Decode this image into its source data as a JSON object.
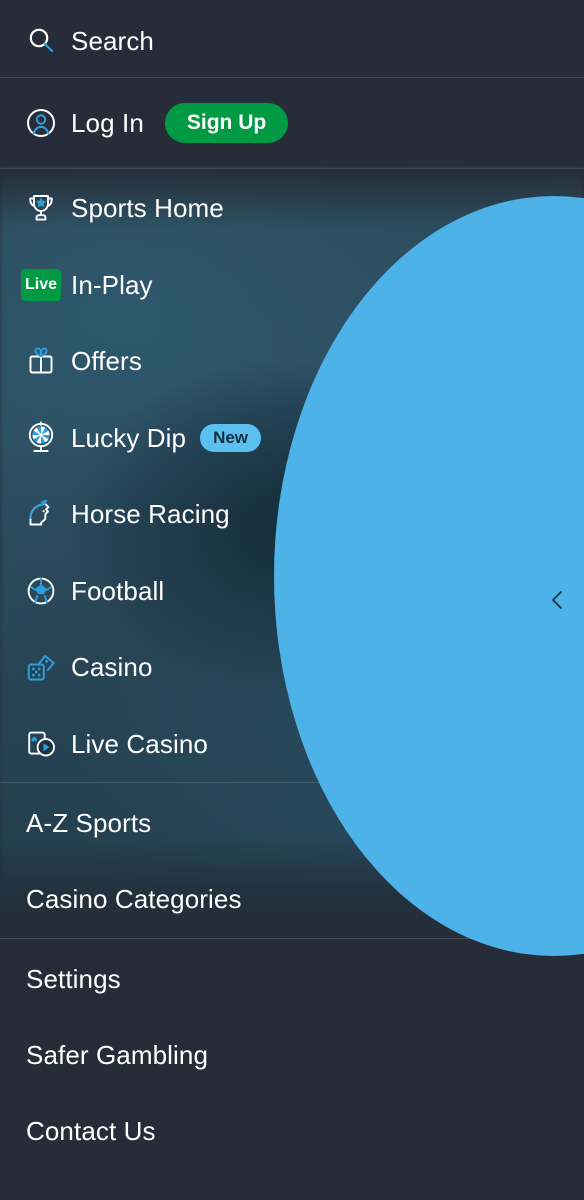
{
  "app": {
    "title": "Sportsbook Navigation Drawer",
    "background_color": "#262d38",
    "hero_background_color": "#2d5063",
    "accent_blue": "#2f9fdb",
    "panel_blue": "#4db2e8",
    "accent_green": "#009a44",
    "badge_blue": "#5bc0ef",
    "text_color": "#ffffff"
  },
  "top": {
    "search": {
      "label": "Search",
      "icon": "search-icon"
    },
    "account": {
      "label": "Log In",
      "icon": "account-circle-icon"
    },
    "signup": {
      "label": "Sign Up"
    }
  },
  "primary_nav": {
    "items": [
      {
        "label": "Sports Home",
        "icon": "trophy-icon",
        "badge": null
      },
      {
        "label": "In-Play",
        "icon": "live-badge-icon",
        "badge": "Live"
      },
      {
        "label": "Offers",
        "icon": "gift-icon",
        "badge": null
      },
      {
        "label": "Lucky Dip",
        "icon": "prize-wheel-icon",
        "badge": "New"
      },
      {
        "label": "Horse Racing",
        "icon": "horse-head-icon",
        "badge": null
      },
      {
        "label": "Football",
        "icon": "football-icon",
        "badge": null
      },
      {
        "label": "Casino",
        "icon": "dice-icon",
        "badge": null
      },
      {
        "label": "Live Casino",
        "icon": "live-casino-card-icon",
        "badge": null
      }
    ]
  },
  "category_nav": {
    "items": [
      {
        "label": "A-Z Sports",
        "chevron": "chevron-right-icon"
      },
      {
        "label": "Casino Categories",
        "chevron": "chevron-right-icon"
      }
    ]
  },
  "footer_nav": {
    "items": [
      {
        "label": "Settings"
      },
      {
        "label": "Safer Gambling"
      },
      {
        "label": "Contact Us"
      }
    ]
  },
  "side_panel": {
    "back_icon": "chevron-left-icon"
  }
}
